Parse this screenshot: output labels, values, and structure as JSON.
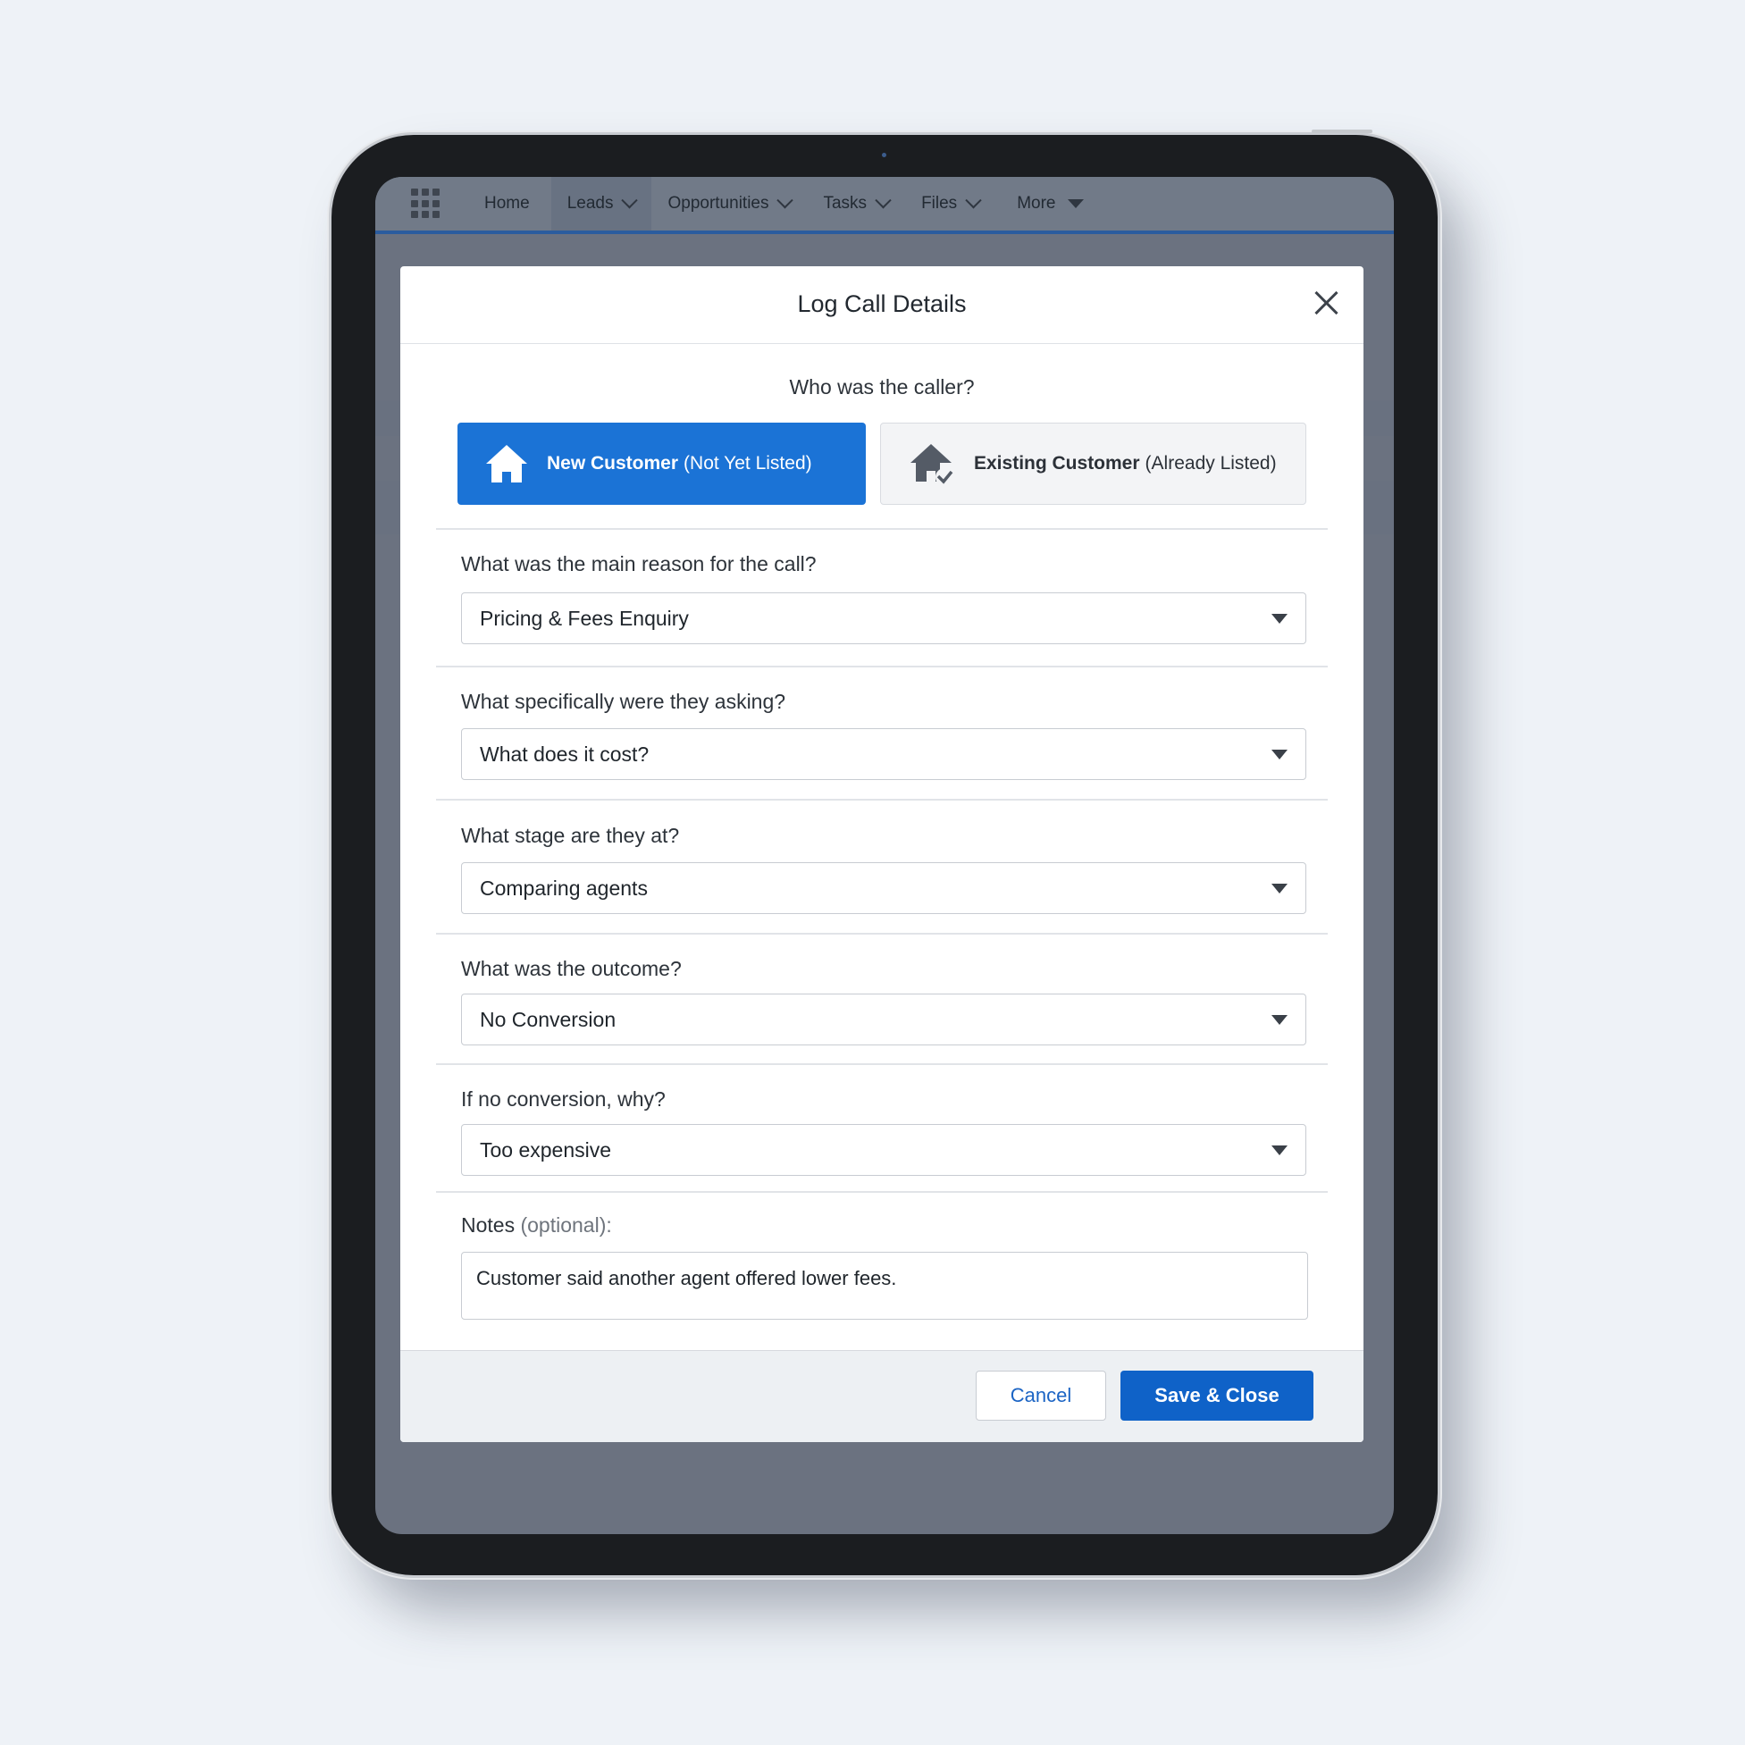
{
  "nav": {
    "items": [
      {
        "label": "Home"
      },
      {
        "label": "Leads"
      },
      {
        "label": "Opportunities"
      },
      {
        "label": "Tasks"
      },
      {
        "label": "Files"
      },
      {
        "label": "More"
      }
    ]
  },
  "modal": {
    "title": "Log Call Details",
    "caller_question": "Who was the caller?",
    "caller_options": [
      {
        "label": "New Customer",
        "sub": "(Not Yet Listed)",
        "selected": true,
        "icon": "house-icon"
      },
      {
        "label": "Existing Customer",
        "sub": "(Already Listed)",
        "selected": false,
        "icon": "house-check-icon"
      }
    ],
    "fields": [
      {
        "label": "What was the main reason for the call?",
        "value": "Pricing & Fees Enquiry"
      },
      {
        "label": "What specifically were they asking?",
        "value": "What does it cost?"
      },
      {
        "label": "What stage are they at?",
        "value": "Comparing agents"
      },
      {
        "label": "What was the outcome?",
        "value": "No Conversion"
      },
      {
        "label": "If no conversion, why?",
        "value": "Too expensive"
      }
    ],
    "notes": {
      "label": "Notes",
      "optional": "(optional):",
      "value": "Customer said another agent offered lower fees."
    },
    "cancel_label": "Cancel",
    "save_label": "Save & Close"
  },
  "colors": {
    "primary": "#1b73d6",
    "save_button": "#0f62c8",
    "nav_accent": "#2b5c9e"
  }
}
